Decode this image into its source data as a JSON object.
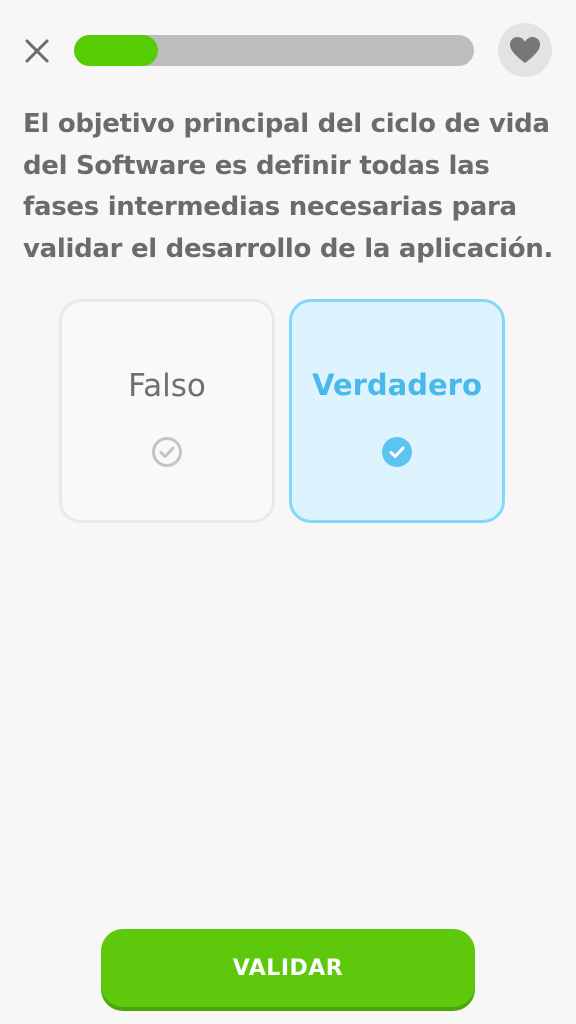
{
  "header": {
    "close_icon": "close-icon",
    "progress": 0.21,
    "progress_color": "#58cc02",
    "heart_icon": "heart-icon"
  },
  "question": {
    "text": "El objetivo principal del ciclo de vida del Software es definir todas las fases intermedias necesarias para validar el desarrollo de la aplicación."
  },
  "options": [
    {
      "label": "Falso",
      "selected": false,
      "icon": "check-circle-outline-icon"
    },
    {
      "label": "Verdadero",
      "selected": true,
      "icon": "check-circle-filled-icon"
    }
  ],
  "colors": {
    "accent_green": "#58cc02",
    "selected_blue": "#48b9ea",
    "selected_bg": "#ddf4ff"
  },
  "footer": {
    "validate_label": "VALIDAR"
  }
}
